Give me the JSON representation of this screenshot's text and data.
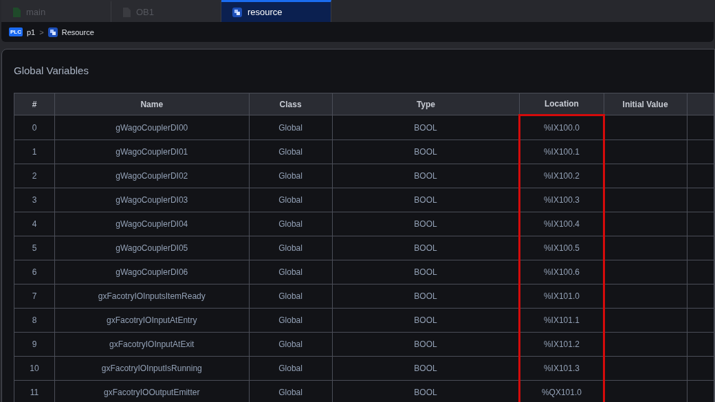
{
  "tabs": [
    {
      "label": "main",
      "kind": "program",
      "selected": false
    },
    {
      "label": "OB1",
      "kind": "block",
      "selected": false
    },
    {
      "label": "resource",
      "kind": "resource",
      "selected": true
    }
  ],
  "breadcrumb": {
    "badge": "PLC",
    "project": "p1",
    "separator": ">",
    "item": "Resource"
  },
  "panel": {
    "title": "Global Variables"
  },
  "table": {
    "columns": [
      {
        "label": "#",
        "highlighted": false
      },
      {
        "label": "Name",
        "highlighted": false
      },
      {
        "label": "Class",
        "highlighted": false
      },
      {
        "label": "Type",
        "highlighted": false
      },
      {
        "label": "Location",
        "highlighted": true
      },
      {
        "label": "Initial Value",
        "highlighted": false
      }
    ],
    "rows": [
      [
        "0",
        "gWagoCouplerDI00",
        "Global",
        "BOOL",
        "%IX100.0",
        ""
      ],
      [
        "1",
        "gWagoCouplerDI01",
        "Global",
        "BOOL",
        "%IX100.1",
        ""
      ],
      [
        "2",
        "gWagoCouplerDI02",
        "Global",
        "BOOL",
        "%IX100.2",
        ""
      ],
      [
        "3",
        "gWagoCouplerDI03",
        "Global",
        "BOOL",
        "%IX100.3",
        ""
      ],
      [
        "4",
        "gWagoCouplerDI04",
        "Global",
        "BOOL",
        "%IX100.4",
        ""
      ],
      [
        "5",
        "gWagoCouplerDI05",
        "Global",
        "BOOL",
        "%IX100.5",
        ""
      ],
      [
        "6",
        "gWagoCouplerDI06",
        "Global",
        "BOOL",
        "%IX100.6",
        ""
      ],
      [
        "7",
        "gxFacotryIOInputsItemReady",
        "Global",
        "BOOL",
        "%IX101.0",
        ""
      ],
      [
        "8",
        "gxFacotryIOInputAtEntry",
        "Global",
        "BOOL",
        "%IX101.1",
        ""
      ],
      [
        "9",
        "gxFacotryIOInputAtExit",
        "Global",
        "BOOL",
        "%IX101.2",
        ""
      ],
      [
        "10",
        "gxFacotryIOInputIsRunning",
        "Global",
        "BOOL",
        "%IX101.3",
        ""
      ],
      [
        "11",
        "gxFacotryIOOutputEmitter",
        "Global",
        "BOOL",
        "%QX101.0",
        ""
      ]
    ]
  }
}
